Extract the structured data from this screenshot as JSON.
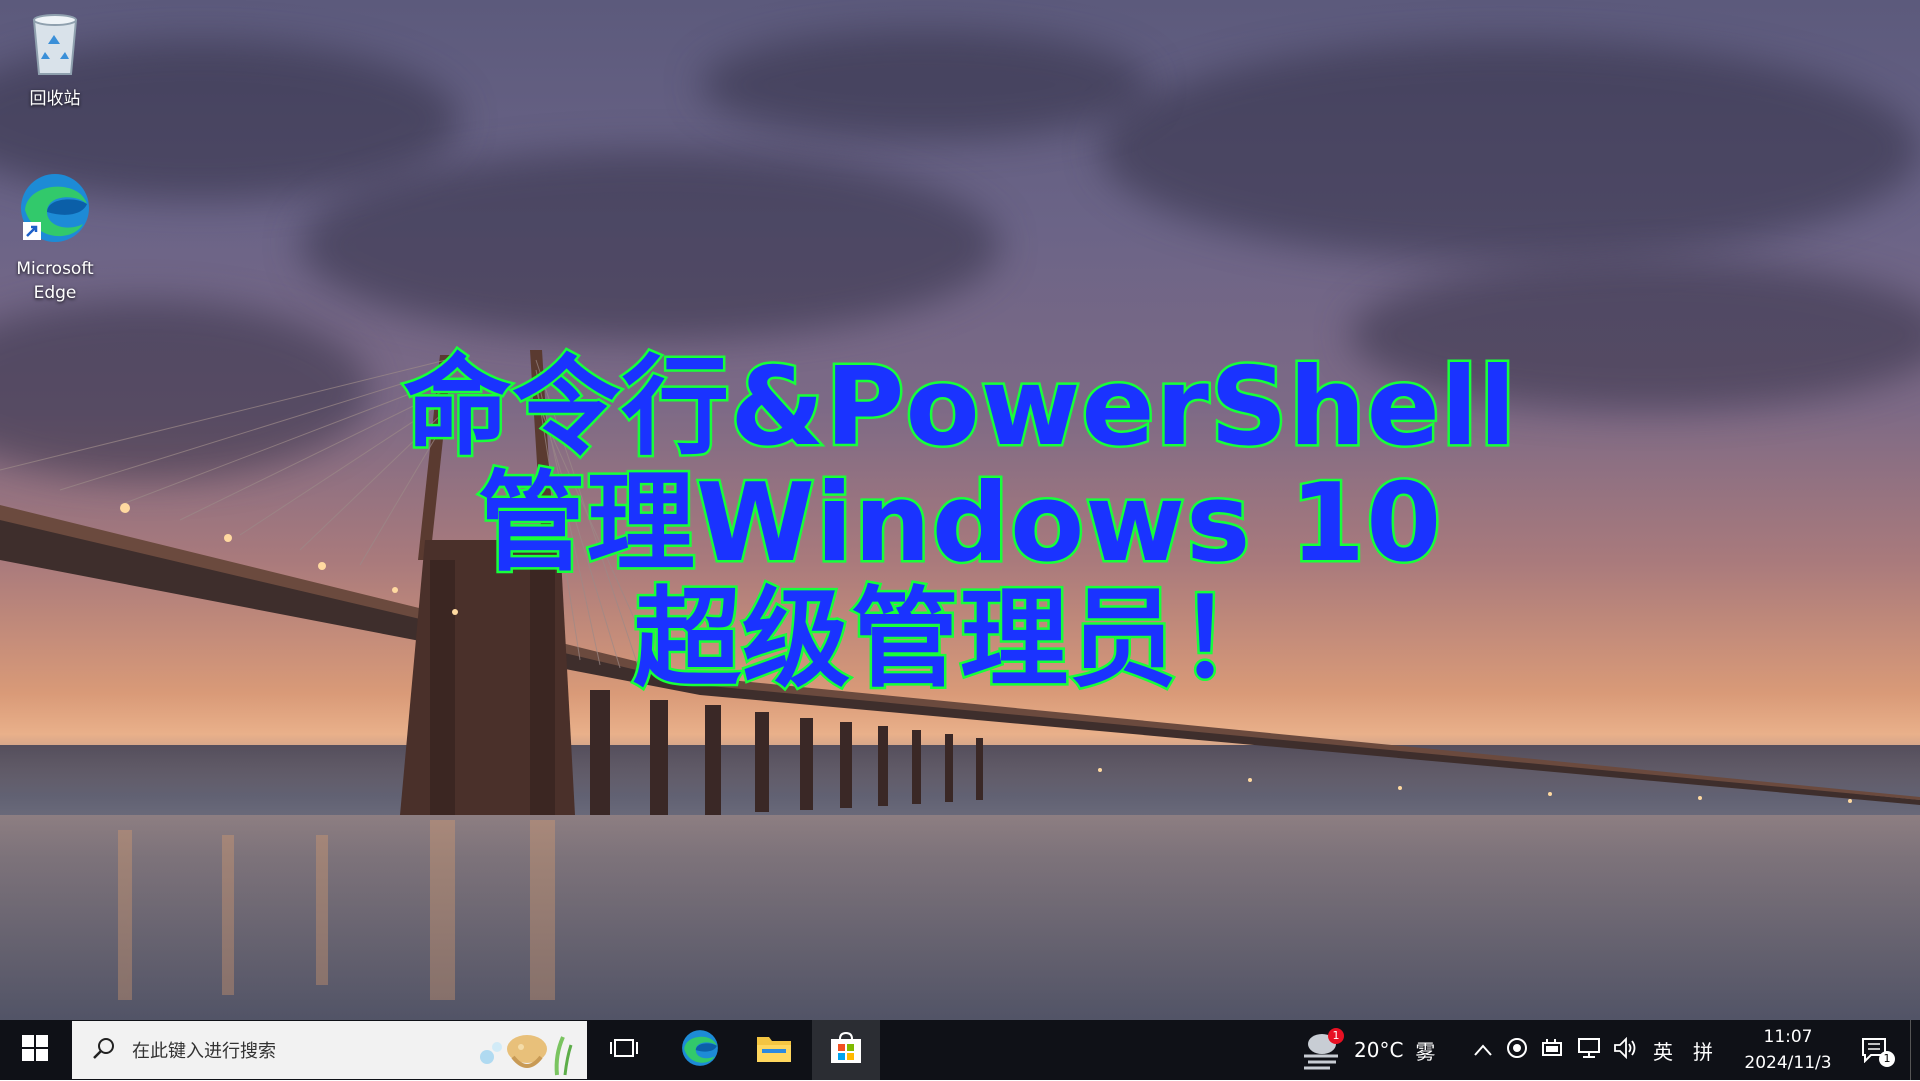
{
  "desktop": {
    "icons": [
      {
        "label": "回收站",
        "icon": "recycle-bin-icon"
      },
      {
        "label": "Microsoft Edge",
        "icon": "edge-icon"
      }
    ],
    "overlay_title": {
      "line1": "命令行&PowerShell",
      "line2": "管理Windows 10",
      "line3": "超级管理员！"
    }
  },
  "taskbar": {
    "start_icon": "windows-start-icon",
    "search_placeholder": "在此键入进行搜索",
    "pinned": [
      {
        "name": "task-view",
        "icon": "task-view-icon"
      },
      {
        "name": "edge",
        "icon": "edge-icon"
      },
      {
        "name": "file-explorer",
        "icon": "folder-icon"
      },
      {
        "name": "microsoft-store",
        "icon": "store-icon"
      }
    ],
    "weather": {
      "temperature": "20°C",
      "condition": "雾",
      "badge": "1"
    },
    "tray": {
      "ime_lang": "英",
      "ime_mode": "拼"
    },
    "clock": {
      "time": "11:07",
      "date": "2024/11/3"
    },
    "notifications_badge": "1"
  },
  "colors": {
    "title_fill": "#1a33ff",
    "title_outline": "#18ff3a",
    "taskbar_bg": "#0f1117"
  }
}
